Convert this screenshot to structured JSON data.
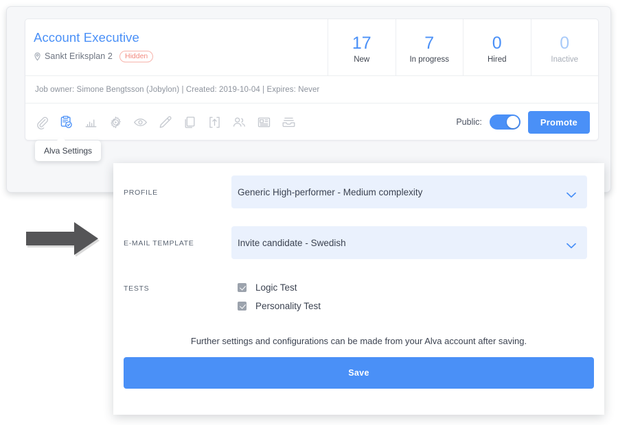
{
  "job": {
    "title": "Account Executive",
    "location": "Sankt Eriksplan 2",
    "location_icon": "map-pin-icon",
    "visibility_badge": "Hidden",
    "meta": "Job owner: Simone Bengtsson (Jobylon)  |  Created: 2019-10-04  |  Expires: Never",
    "stats": [
      {
        "value": "17",
        "label": "New",
        "muted": false
      },
      {
        "value": "7",
        "label": "In progress",
        "muted": false
      },
      {
        "value": "0",
        "label": "Hired",
        "muted": false
      },
      {
        "value": "0",
        "label": "Inactive",
        "muted": true
      }
    ]
  },
  "toolbar": {
    "icons": [
      {
        "name": "paperclip-icon",
        "active": false
      },
      {
        "name": "clipboard-check-icon",
        "active": true
      },
      {
        "name": "bar-chart-icon",
        "active": false
      },
      {
        "name": "gear-play-icon",
        "active": false
      },
      {
        "name": "eye-icon",
        "active": false
      },
      {
        "name": "pencil-icon",
        "active": false
      },
      {
        "name": "copy-icon",
        "active": false
      },
      {
        "name": "upload-box-icon",
        "active": false
      },
      {
        "name": "people-icon",
        "active": false
      },
      {
        "name": "article-icon",
        "active": false
      },
      {
        "name": "archive-icon",
        "active": false
      }
    ],
    "public_label": "Public:",
    "public_on": true,
    "promote_label": "Promote"
  },
  "tooltip": {
    "text": "Alva Settings"
  },
  "annotation": {
    "arrow": "right-arrow-annotation",
    "color": "#555557"
  },
  "modal": {
    "profile": {
      "label": "PROFILE",
      "value": "Generic High-performer - Medium complexity"
    },
    "email_template": {
      "label": "E-MAIL TEMPLATE",
      "value": "Invite candidate - Swedish"
    },
    "tests": {
      "label": "TESTS",
      "items": [
        {
          "label": "Logic Test",
          "checked": true
        },
        {
          "label": "Personality Test",
          "checked": true
        }
      ]
    },
    "note": "Further settings and configurations can be made from your Alva account after saving.",
    "save_label": "Save"
  },
  "colors": {
    "accent_blue": "#4a90f7",
    "badge_coral": "#f2897e",
    "select_bg": "#eaf1fd",
    "frame_bg": "#f6f7f9"
  }
}
